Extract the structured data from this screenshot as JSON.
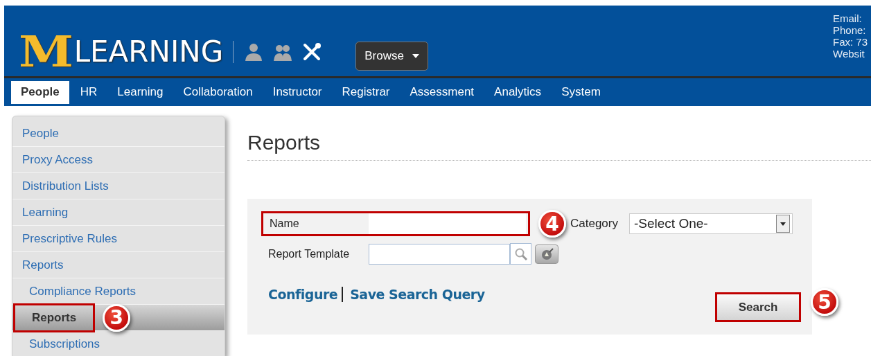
{
  "header": {
    "logo": {
      "mark": "M",
      "text": "LEARNING"
    },
    "browse_button": "Browse",
    "contact": [
      "Email:",
      "Phone:",
      "Fax: 73",
      "Websit"
    ]
  },
  "nav_tabs": [
    {
      "label": "People",
      "selected": true
    },
    {
      "label": "HR",
      "selected": false
    },
    {
      "label": "Learning",
      "selected": false
    },
    {
      "label": "Collaboration",
      "selected": false
    },
    {
      "label": "Instructor",
      "selected": false
    },
    {
      "label": "Registrar",
      "selected": false
    },
    {
      "label": "Assessment",
      "selected": false
    },
    {
      "label": "Analytics",
      "selected": false
    },
    {
      "label": "System",
      "selected": false
    }
  ],
  "sidebar": {
    "items": [
      {
        "label": "People",
        "selected": false
      },
      {
        "label": "Proxy Access",
        "selected": false
      },
      {
        "label": "Distribution Lists",
        "selected": false
      },
      {
        "label": "Learning",
        "selected": false
      },
      {
        "label": "Prescriptive Rules",
        "selected": false
      },
      {
        "label": "Reports",
        "selected": false,
        "children": [
          {
            "label": "Compliance Reports",
            "selected": false
          },
          {
            "label": "Reports",
            "selected": true,
            "highlighted": true,
            "callout": "3"
          },
          {
            "label": "Subscriptions",
            "selected": false
          }
        ]
      }
    ]
  },
  "page_title": "Reports",
  "form": {
    "name_field": {
      "label": "Name",
      "highlighted": true,
      "callout": "4"
    },
    "category_field": {
      "label": "Category",
      "value": "-Select One-"
    },
    "template_field": {
      "label": "Report Template"
    },
    "links": [
      "Configure",
      "Save Search Query"
    ],
    "search_button": {
      "label": "Search",
      "highlighted": true,
      "callout": "5"
    }
  }
}
